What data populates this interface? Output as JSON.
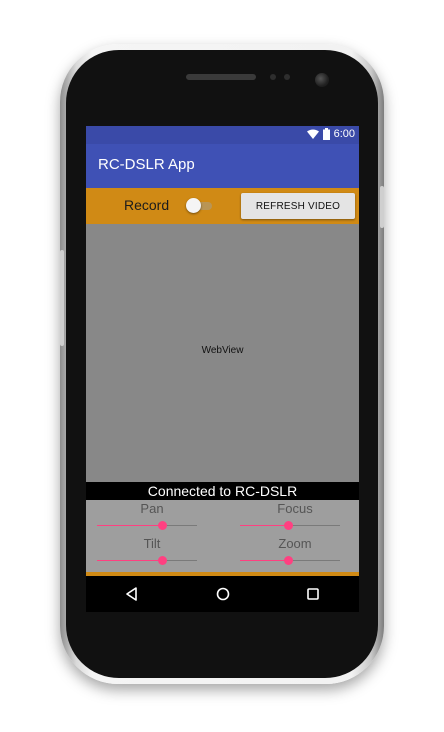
{
  "status_bar": {
    "time": "6:00",
    "icons": [
      "wifi-icon",
      "battery-icon"
    ]
  },
  "app_bar": {
    "title": "RC-DSLR App"
  },
  "toolbar": {
    "record_label": "Record",
    "record_switch_on": false,
    "refresh_button_label": "REFRESH VIDEO"
  },
  "webview": {
    "placeholder": "WebView"
  },
  "connection": {
    "status_text": "Connected to RC-DSLR"
  },
  "controls": {
    "pan": {
      "label": "Pan",
      "value": 0.65
    },
    "focus": {
      "label": "Focus",
      "value": 0.48
    },
    "tilt": {
      "label": "Tilt",
      "value": 0.65
    },
    "zoom": {
      "label": "Zoom",
      "value": 0.48
    }
  },
  "nav_bar": {
    "icons": [
      "back-icon",
      "home-icon",
      "recents-icon"
    ]
  },
  "colors": {
    "status_bar": "#3a4aa8",
    "app_bar": "#3f51b5",
    "accent_orange": "#d08a15",
    "slider_accent": "#ff4081",
    "webview_bg": "#888888",
    "controls_bg": "#9e9e9e"
  }
}
